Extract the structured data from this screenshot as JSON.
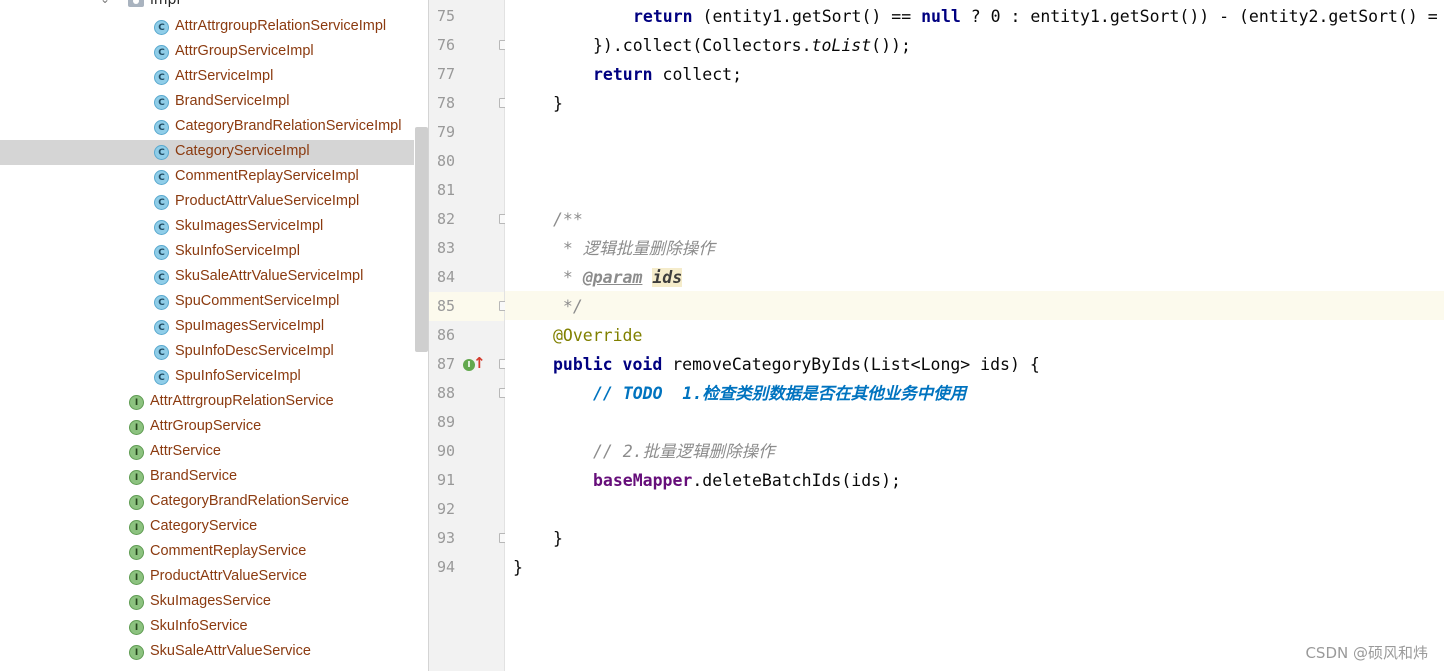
{
  "tree": {
    "folder_label": "impl",
    "impl_items": [
      "AttrAttrgroupRelationServiceImpl",
      "AttrGroupServiceImpl",
      "AttrServiceImpl",
      "BrandServiceImpl",
      "CategoryBrandRelationServiceImpl",
      "CategoryServiceImpl",
      "CommentReplayServiceImpl",
      "ProductAttrValueServiceImpl",
      "SkuImagesServiceImpl",
      "SkuInfoServiceImpl",
      "SkuSaleAttrValueServiceImpl",
      "SpuCommentServiceImpl",
      "SpuImagesServiceImpl",
      "SpuInfoDescServiceImpl",
      "SpuInfoServiceImpl"
    ],
    "selected_item": "CategoryServiceImpl",
    "interface_items": [
      "AttrAttrgroupRelationService",
      "AttrGroupService",
      "AttrService",
      "BrandService",
      "CategoryBrandRelationService",
      "CategoryService",
      "CommentReplayService",
      "ProductAttrValueService",
      "SkuImagesService",
      "SkuInfoService",
      "SkuSaleAttrValueService"
    ],
    "class_icon_letter": "C",
    "interface_icon_letter": "I"
  },
  "editor": {
    "line_numbers": [
      "75",
      "76",
      "77",
      "78",
      "79",
      "80",
      "81",
      "82",
      "83",
      "84",
      "85",
      "86",
      "87",
      "88",
      "89",
      "90",
      "91",
      "92",
      "93",
      "94"
    ],
    "current_line": "85",
    "gutter_impl_letter": "I",
    "code": {
      "l75a": "return",
      "l75b": " (entity1.getSort() == ",
      "l75c": "null",
      "l75d": " ? 0 : entity1.getSort()) - (entity2.getSort() =",
      "l76a": "}).collect(Collectors.",
      "l76b": "toList",
      "l76c": "());",
      "l77a": "return",
      "l77b": " collect;",
      "l78": "}",
      "l82": "/**",
      "l83": " * 逻辑批量删除操作",
      "l84a": " * ",
      "l84b": "@param",
      "l84c": " ",
      "l84d": "ids",
      "l85": " */",
      "l86": "@Override",
      "l87a": "public",
      "l87b": " ",
      "l87c": "void",
      "l87d": " removeCategoryByIds(List<Long> ids) {",
      "l88a": "// ",
      "l88b": "TODO  1.检查类别数据是否在其他业务中使用",
      "l90": "// 2.批量逻辑删除操作",
      "l91a": "baseMapper",
      "l91b": ".deleteBatchIds(ids);",
      "l93": "}",
      "l94": "}"
    }
  },
  "watermark": "CSDN @硕风和炜",
  "colors": {
    "keyword": "#000080",
    "comment": "#8c8c8c",
    "annotation": "#808000",
    "todo": "#0073bf",
    "tree_label": "#8b3a0f",
    "selection": "#d5d5d5",
    "current_line": "#fcfaed"
  }
}
